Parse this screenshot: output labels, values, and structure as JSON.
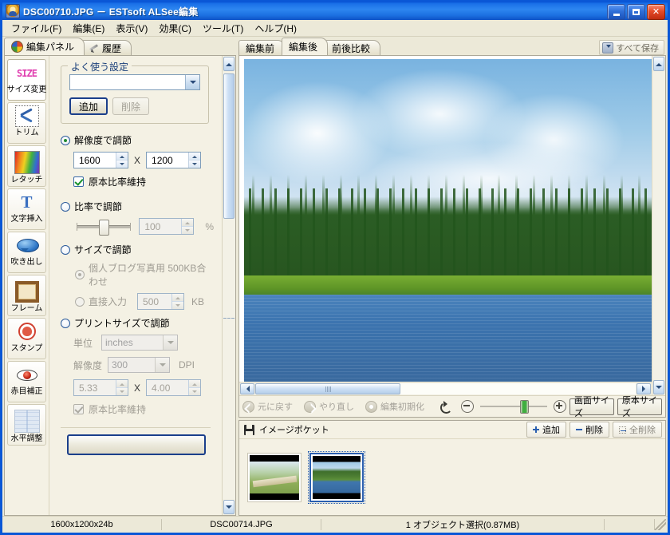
{
  "window": {
    "title": "DSC00710.JPG － ESTsoft ALSee編集",
    "icon": "app-icon",
    "controls": {
      "minimize": "_",
      "maximize": "□",
      "close": "✕"
    }
  },
  "menu": {
    "items": [
      {
        "label": "ファイル(F)"
      },
      {
        "label": "編集(E)"
      },
      {
        "label": "表示(V)"
      },
      {
        "label": "効果(C)"
      },
      {
        "label": "ツール(T)"
      },
      {
        "label": "ヘルプ(H)"
      }
    ]
  },
  "left_panel": {
    "tabs": [
      {
        "label": "編集パネル",
        "icon": "palette-icon",
        "active": true
      },
      {
        "label": "履歴",
        "icon": "pencil-icon",
        "active": false
      }
    ],
    "tools": [
      {
        "label": "サイズ変更",
        "icon": "size-icon",
        "active": true,
        "glyph_text": "SIZE"
      },
      {
        "label": "トリム",
        "icon": "scissors-icon",
        "active": false
      },
      {
        "label": "レタッチ",
        "icon": "color-gradient-icon",
        "active": false
      },
      {
        "label": "文字挿入",
        "icon": "text-icon",
        "active": false,
        "glyph_text": "T"
      },
      {
        "label": "吹き出し",
        "icon": "speech-balloon-icon",
        "active": false
      },
      {
        "label": "フレーム",
        "icon": "frame-icon",
        "active": false
      },
      {
        "label": "スタンプ",
        "icon": "stamp-icon",
        "active": false
      },
      {
        "label": "赤目補正",
        "icon": "red-eye-icon",
        "active": false
      },
      {
        "label": "水平調整",
        "icon": "level-grid-icon",
        "active": false
      }
    ],
    "presets": {
      "group_title": "よく使う設定",
      "combo_value": "",
      "add_label": "追加",
      "delete_label": "削除"
    },
    "resolution": {
      "radio_label": "解像度で調節",
      "width": "1600",
      "x_separator": "X",
      "height": "1200",
      "keep_ratio_label": "原本比率維持"
    },
    "ratio": {
      "radio_label": "比率で調節",
      "value": "100",
      "unit": "%"
    },
    "filesize": {
      "radio_label": "サイズで調節",
      "preset_label": "個人ブログ写真用 500KB合わせ",
      "direct_label": "直接入力",
      "direct_value": "500",
      "unit": "KB"
    },
    "printsize": {
      "radio_label": "プリントサイズで調節",
      "unit_label": "単位",
      "unit_value": "inches",
      "dpi_label": "解像度",
      "dpi_value": "300",
      "dpi_unit": "DPI",
      "width": "5.33",
      "x_separator": "X",
      "height": "4.00",
      "keep_ratio_label": "原本比率維持"
    }
  },
  "right_panel": {
    "tabs": [
      {
        "label": "編集前",
        "active": false
      },
      {
        "label": "編集後",
        "active": true
      },
      {
        "label": "前後比較",
        "active": false
      }
    ],
    "save_all_label": "すべて保存",
    "save_all_icon": "download-icon",
    "edit_toolbar": {
      "undo_label": "元に戻す",
      "redo_label": "やり直し",
      "reset_label": "編集初期化",
      "rotate_icon": "rotate-icon",
      "zoom_out_icon": "zoom-out-icon",
      "zoom_in_icon": "zoom-in-icon",
      "fit_screen_label": "画面サイズ",
      "original_size_label": "原本サイズ"
    },
    "pocket": {
      "title": "イメージポケット",
      "icon": "floppy-icon",
      "add_label": "追加",
      "delete_label": "削除",
      "delete_all_label": "全削除",
      "thumbnails": [
        {
          "name": "thumbnail-1",
          "selected": false
        },
        {
          "name": "thumbnail-2",
          "selected": true
        }
      ]
    }
  },
  "statusbar": {
    "dimensions": "1600x1200x24b",
    "filename": "DSC00714.JPG",
    "selection": "1 オブジェクト選択(0.87MB)",
    "extra": ""
  },
  "colors": {
    "titlebar_blue": "#1b71e8",
    "window_border": "#0a57d6",
    "face": "#ece9d8",
    "panel": "#f4f1e4",
    "close_red": "#e44a28",
    "accent_blue": "#2a5fb0"
  }
}
